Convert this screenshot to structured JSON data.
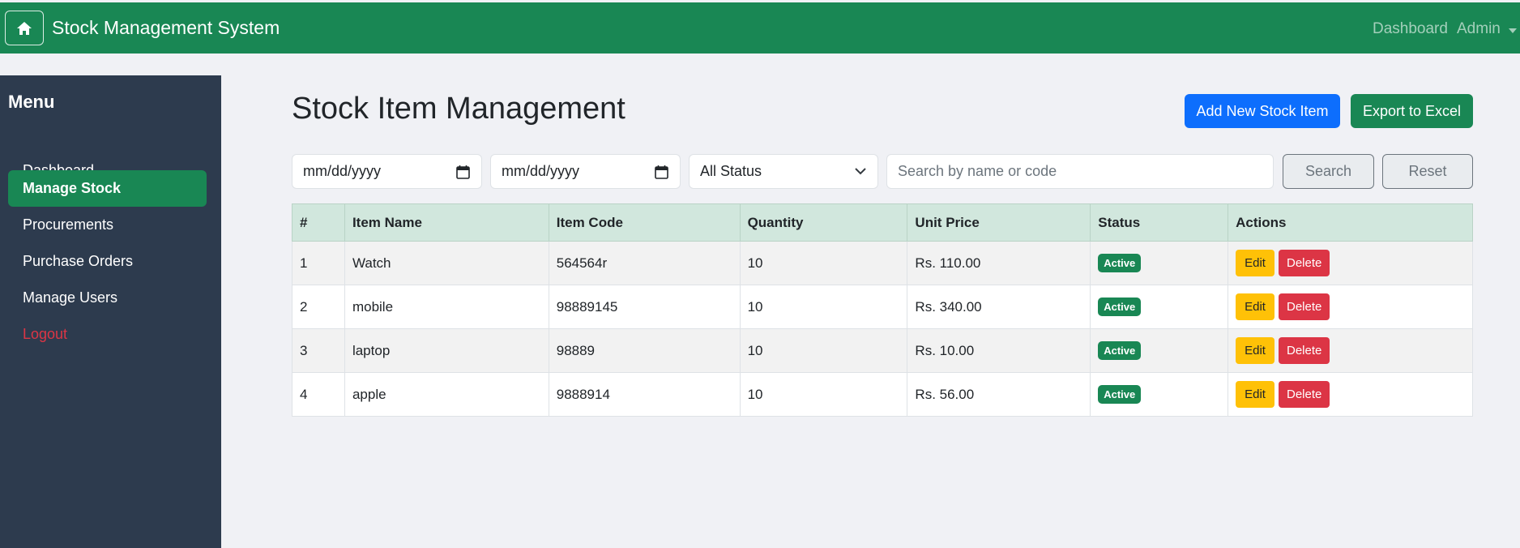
{
  "navbar": {
    "brand": "Stock Management System",
    "links": [
      "Dashboard",
      "Admin"
    ],
    "bg_color": "#198754",
    "home_icon": "home-icon"
  },
  "sidebar": {
    "title": "Menu",
    "items": [
      {
        "label": "Dashboard"
      },
      {
        "label": "Manage Stock",
        "active": true
      },
      {
        "label": "Procurements"
      },
      {
        "label": "Purchase Orders"
      },
      {
        "label": "Manage Users"
      },
      {
        "label": "Logout",
        "color": "#dc3545"
      }
    ],
    "bg_color": "#2d3b4e"
  },
  "main": {
    "title": "Stock Item Management",
    "add_button": "Add New Stock Item",
    "export_button": "Export to Excel"
  },
  "filters": {
    "date_from_placeholder": "mm/dd/yyyy",
    "date_to_placeholder": "mm/dd/yyyy",
    "status_selected": "All Status",
    "search_placeholder": "Search by name or code",
    "search_button": "Search",
    "reset_button": "Reset"
  },
  "table": {
    "headers": [
      "#",
      "Item Name",
      "Item Code",
      "Quantity",
      "Unit Price",
      "Status",
      "Actions"
    ],
    "rows": [
      {
        "num": "1",
        "name": "Watch",
        "code": "564564r",
        "qty": "10",
        "price": "Rs. 110.00",
        "status": "Active"
      },
      {
        "num": "2",
        "name": "mobile",
        "code": "98889145",
        "qty": "10",
        "price": "Rs. 340.00",
        "status": "Active"
      },
      {
        "num": "3",
        "name": "laptop",
        "code": "98889",
        "qty": "10",
        "price": "Rs. 10.00",
        "status": "Active"
      },
      {
        "num": "4",
        "name": "apple",
        "code": "9888914",
        "qty": "10",
        "price": "Rs. 56.00",
        "status": "Active"
      }
    ],
    "edit_label": "Edit",
    "delete_label": "Delete"
  }
}
